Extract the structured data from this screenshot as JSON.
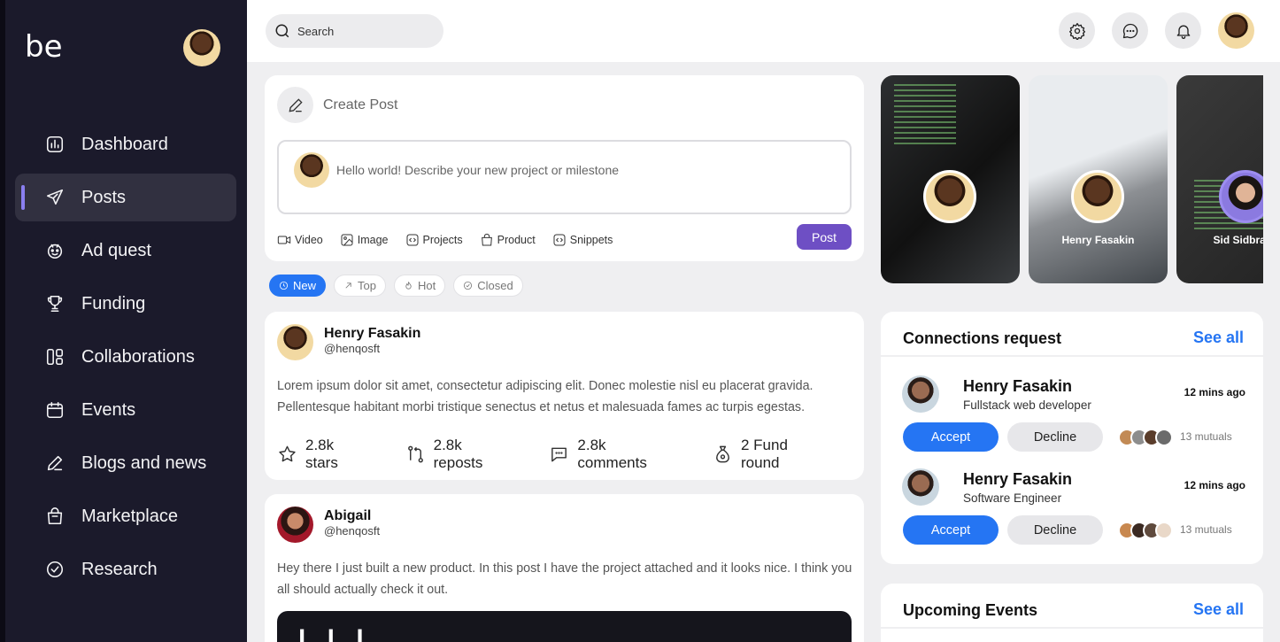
{
  "brand": {
    "logo_text": "be"
  },
  "sidebar": {
    "items": [
      {
        "label": "Dashboard",
        "icon": "dashboard-icon"
      },
      {
        "label": "Posts",
        "icon": "send-icon",
        "active": true
      },
      {
        "label": "Ad quest",
        "icon": "smiley-icon"
      },
      {
        "label": "Funding",
        "icon": "trophy-icon"
      },
      {
        "label": "Collaborations",
        "icon": "layout-icon"
      },
      {
        "label": "Events",
        "icon": "calendar-icon"
      },
      {
        "label": "Blogs and news",
        "icon": "pen-icon"
      },
      {
        "label": "Marketplace",
        "icon": "bag-icon"
      },
      {
        "label": "Research",
        "icon": "check-circle-icon"
      }
    ]
  },
  "topbar": {
    "search_placeholder": "Search",
    "icons": [
      "gear-icon",
      "chat-icon",
      "bell-icon"
    ]
  },
  "create_post": {
    "title": "Create Post",
    "placeholder": "Hello world! Describe your new project or milestone",
    "tools": [
      "Video",
      "Image",
      "Projects",
      "Product",
      "Snippets"
    ],
    "post_label": "Post"
  },
  "filters": [
    {
      "label": "New",
      "active": true
    },
    {
      "label": "Top"
    },
    {
      "label": "Hot"
    },
    {
      "label": "Closed"
    }
  ],
  "posts": [
    {
      "name": "Henry Fasakin",
      "handle": "@henqosft",
      "text": "Lorem ipsum dolor sit amet, consectetur adipiscing elit. Donec molestie nisl eu placerat gravida. Pellentesque habitant morbi tristique senectus et netus et malesuada fames ac turpis egestas.",
      "stats": {
        "stars": "2.8k stars",
        "reposts": "2.8k reposts",
        "comments": "2.8k comments",
        "fund": "2 Fund round"
      }
    },
    {
      "name": "Abigail",
      "handle": "@henqosft",
      "text": "Hey there I just built a new product. In this post I have the project attached and it looks nice. I think you all should actually check it out.",
      "media_text": "l l l"
    }
  ],
  "stories": [
    {
      "name": ""
    },
    {
      "name": "Henry Fasakin"
    },
    {
      "name": "Sid Sidbrand"
    }
  ],
  "connections": {
    "title": "Connections request",
    "see_all": "See all",
    "requests": [
      {
        "name": "Henry Fasakin",
        "role": "Fullstack web developer",
        "time": "12 mins ago",
        "accept": "Accept",
        "decline": "Decline",
        "mutuals": "13 mutuals"
      },
      {
        "name": "Henry Fasakin",
        "role": "Software Engineer",
        "time": "12 mins ago",
        "accept": "Accept",
        "decline": "Decline",
        "mutuals": "13 mutuals"
      }
    ]
  },
  "events": {
    "title": "Upcoming Events",
    "see_all": "See all"
  },
  "colors": {
    "sidebar": "#1b1a2b",
    "accent_blue": "#2575f3",
    "accent_purple": "#6e4fc4",
    "active_bar": "#8a7ff0"
  }
}
